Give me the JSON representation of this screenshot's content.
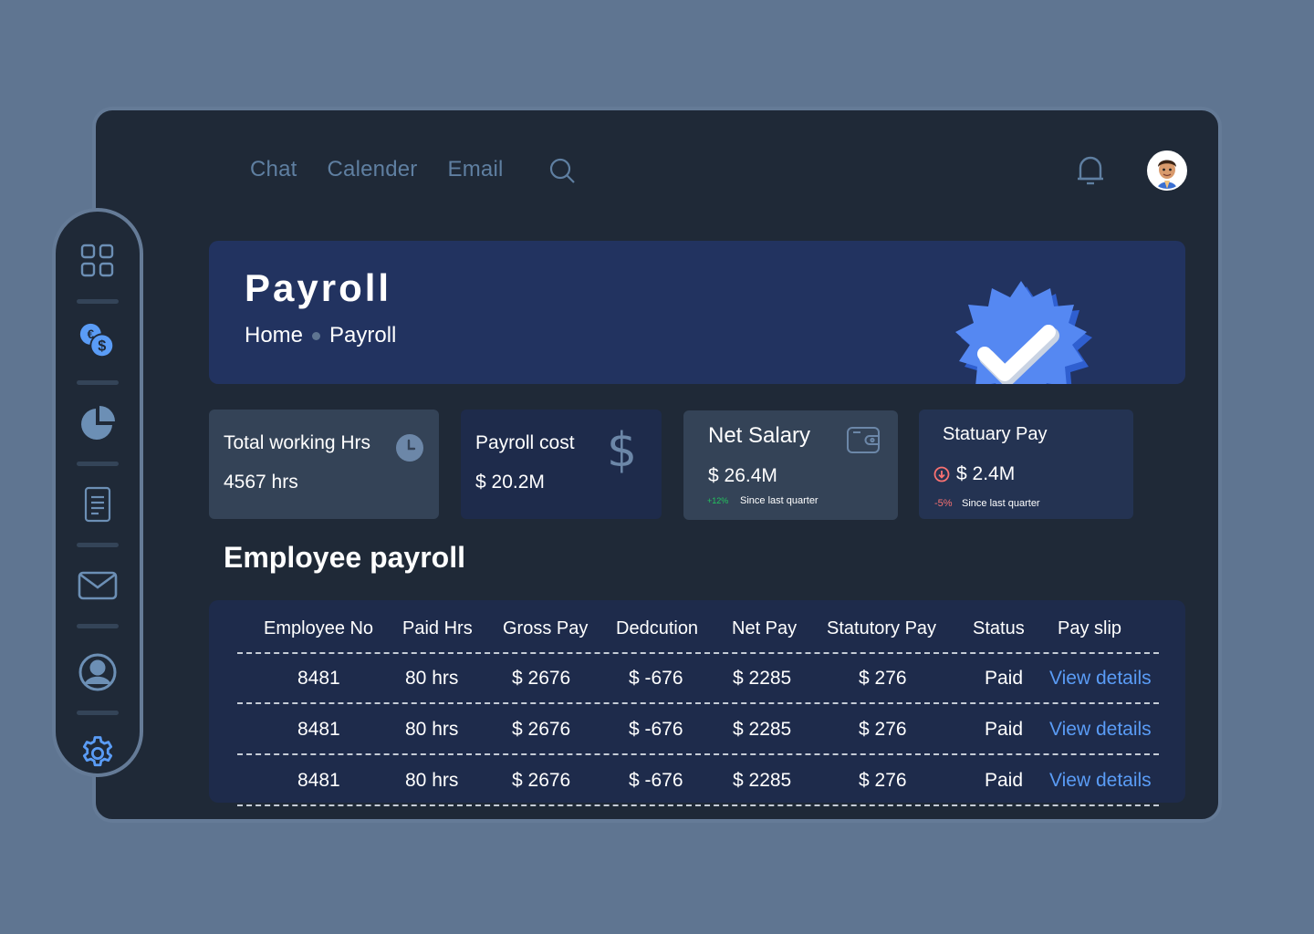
{
  "nav": {
    "items": [
      "Chat",
      "Calender",
      "Email"
    ]
  },
  "banner": {
    "title": "Payroll",
    "crumb_home": "Home",
    "crumb_current": "Payroll"
  },
  "cards": [
    {
      "label": "Total working Hrs",
      "value": "4567 hrs",
      "icon": "clock-icon"
    },
    {
      "label": "Payroll cost",
      "value": "$ 20.2M",
      "icon": "dollar-icon"
    },
    {
      "label": "Net Salary",
      "value": "$ 26.4M",
      "change": "+12%",
      "note": "Since last quarter",
      "icon": "wallet-icon"
    },
    {
      "label": "Statuary Pay",
      "value": "$ 2.4M",
      "change": "-5%",
      "note": "Since last quarter",
      "icon": "arrow-down-circle-icon"
    }
  ],
  "section_title": "Employee payroll",
  "table": {
    "headers": [
      "Employee No",
      "Paid Hrs",
      "Gross Pay",
      "Dedcution",
      "Net Pay",
      "Statutory Pay",
      "Status",
      "Pay slip"
    ],
    "rows": [
      [
        "8481",
        "80 hrs",
        "$ 2676",
        "$ -676",
        "$ 2285",
        "$ 276",
        "Paid",
        "View details"
      ],
      [
        "8481",
        "80 hrs",
        "$ 2676",
        "$ -676",
        "$ 2285",
        "$ 276",
        "Paid",
        "View details"
      ],
      [
        "8481",
        "80 hrs",
        "$ 2676",
        "$ -676",
        "$ 2285",
        "$ 276",
        "Paid",
        "View details"
      ]
    ]
  },
  "colors": {
    "bg": "#5f7591",
    "panel": "#1f2937",
    "banner": "#223360",
    "link": "#5a9cf6",
    "positive": "#22c55e",
    "negative": "#f87171"
  }
}
